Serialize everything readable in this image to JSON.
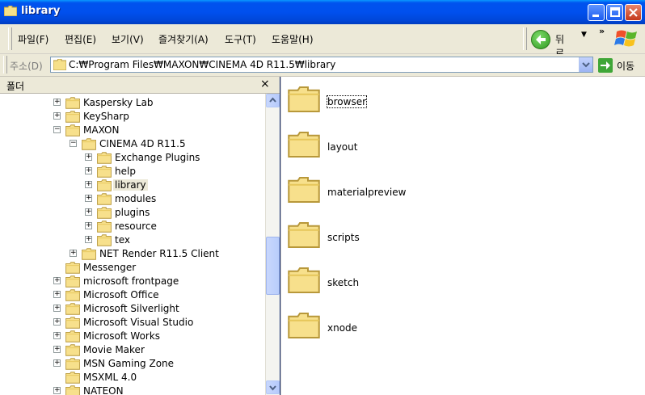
{
  "window": {
    "title": "library",
    "titlebar_color": "#0054e3"
  },
  "menu": {
    "items": [
      "파일(F)",
      "편집(E)",
      "보기(V)",
      "즐겨찾기(A)",
      "도구(T)",
      "도움말(H)"
    ],
    "back_label": "뒤로",
    "overflow": "»"
  },
  "address": {
    "label": "주소(D)",
    "path": "C:₩Program Files₩MAXON₩CINEMA 4D R11.5₩library",
    "go_label": "이동"
  },
  "folder_pane": {
    "title": "폴더",
    "close": "×",
    "tree": [
      {
        "label": "Kaspersky Lab",
        "indent": 0,
        "expander": "+"
      },
      {
        "label": "KeySharp",
        "indent": 0,
        "expander": "+"
      },
      {
        "label": "MAXON",
        "indent": 0,
        "expander": "-"
      },
      {
        "label": "CINEMA 4D R11.5",
        "indent": 1,
        "expander": "-"
      },
      {
        "label": "Exchange Plugins",
        "indent": 2,
        "expander": "+"
      },
      {
        "label": "help",
        "indent": 2,
        "expander": "+"
      },
      {
        "label": "library",
        "indent": 2,
        "expander": "+",
        "selected": true
      },
      {
        "label": "modules",
        "indent": 2,
        "expander": "+"
      },
      {
        "label": "plugins",
        "indent": 2,
        "expander": "+"
      },
      {
        "label": "resource",
        "indent": 2,
        "expander": "+"
      },
      {
        "label": "tex",
        "indent": 2,
        "expander": "+"
      },
      {
        "label": "NET Render R11.5 Client",
        "indent": 1,
        "expander": "+"
      },
      {
        "label": "Messenger",
        "indent": 0,
        "expander": ""
      },
      {
        "label": "microsoft frontpage",
        "indent": 0,
        "expander": "+"
      },
      {
        "label": "Microsoft Office",
        "indent": 0,
        "expander": "+"
      },
      {
        "label": "Microsoft Silverlight",
        "indent": 0,
        "expander": "+"
      },
      {
        "label": "Microsoft Visual Studio",
        "indent": 0,
        "expander": "+"
      },
      {
        "label": "Microsoft Works",
        "indent": 0,
        "expander": "+"
      },
      {
        "label": "Movie Maker",
        "indent": 0,
        "expander": "+"
      },
      {
        "label": "MSN Gaming Zone",
        "indent": 0,
        "expander": "+"
      },
      {
        "label": "MSXML 4.0",
        "indent": 0,
        "expander": ""
      },
      {
        "label": "NATEON",
        "indent": 0,
        "expander": "+"
      }
    ]
  },
  "content": {
    "folders": [
      "browser",
      "layout",
      "materialpreview",
      "scripts",
      "sketch",
      "xnode"
    ],
    "focused": "browser"
  }
}
